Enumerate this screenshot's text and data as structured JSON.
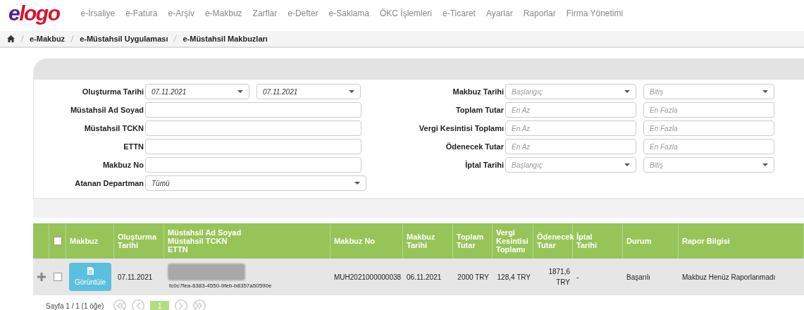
{
  "header": {
    "logo": {
      "prefix": "e",
      "name": "logo"
    },
    "menu": [
      "e-İrsaliye",
      "e-Fatura",
      "e-Arşiv",
      "e-Makbuz",
      "Zarflar",
      "e-Defter",
      "e-Saklama",
      "ÖKC İşlemleri",
      "e-Ticaret",
      "Ayarlar",
      "Raporlar",
      "Firma Yönetimi"
    ]
  },
  "breadcrumb": [
    "e-Makbuz",
    "e-Müstahsil Uygulaması",
    "e-Müstahsil Makbuzları"
  ],
  "filters": {
    "left": [
      {
        "label": "Oluşturma Tarihi",
        "kind": "date_range",
        "fields": [
          {
            "value": "07.11.2021"
          },
          {
            "value": "07.11.2021"
          }
        ]
      },
      {
        "label": "Müstahsil Ad Soyad",
        "kind": "text"
      },
      {
        "label": "Müstahsil TCKN",
        "kind": "text"
      },
      {
        "label": "ETTN",
        "kind": "text"
      },
      {
        "label": "Makbuz No",
        "kind": "text"
      },
      {
        "label": "Atanan Departman",
        "kind": "select",
        "fields": [
          {
            "value": "Tümü"
          }
        ]
      }
    ],
    "right": [
      {
        "label": "Makbuz Tarihi",
        "kind": "date_range",
        "fields": [
          {
            "placeholder": "Başlangıç"
          },
          {
            "placeholder": "Bitiş"
          }
        ]
      },
      {
        "label": "Toplam Tutar",
        "kind": "range",
        "fields": [
          {
            "placeholder": "En Az"
          },
          {
            "placeholder": "En Fazla"
          }
        ]
      },
      {
        "label": "Vergi Kesintisi Toplamı",
        "kind": "range",
        "fields": [
          {
            "placeholder": "En Az"
          },
          {
            "placeholder": "En Fazla"
          }
        ]
      },
      {
        "label": "Ödenecek Tutar",
        "kind": "range",
        "fields": [
          {
            "placeholder": "En Az"
          },
          {
            "placeholder": "En Fazla"
          }
        ]
      },
      {
        "label": "İptal Tarihi",
        "kind": "date_range",
        "fields": [
          {
            "placeholder": "Başlangıç"
          },
          {
            "placeholder": "Bitiş"
          }
        ]
      }
    ]
  },
  "table": {
    "select_all": {
      "checked": false
    },
    "columns": [
      [
        "Makbuz"
      ],
      [
        "Oluşturma",
        "Tarihi"
      ],
      [
        "Müstahsil Ad Soyad",
        "Müstahsil TCKN",
        "ETTN"
      ],
      [
        "Makbuz No"
      ],
      [
        "Makbuz",
        "Tarihi"
      ],
      [
        "Toplam",
        "Tutar"
      ],
      [
        "Vergi",
        "Kesintisi",
        "Toplamı"
      ],
      [
        "Ödenecek",
        "Tutar"
      ],
      [
        "İptal",
        "Tarihi"
      ],
      [
        "Durum"
      ],
      [
        "Rapor Bilgisi"
      ]
    ],
    "rows": [
      {
        "checked": false,
        "view_button": "Görüntüle",
        "created": "07.11.2021",
        "redacted": true,
        "ettn": "fc0c7fea-6383-4550-9feb-b8357a50590e",
        "receipt_no": "MUH2021000000038",
        "receipt_date": "06.11.2021",
        "total": "2000 TRY",
        "tax": "128,4 TRY",
        "payable": [
          "1871,6",
          "TRY"
        ],
        "cancel_date": "-",
        "status": "Başarılı",
        "report": "Makbuz Henüz Raporlanmadı"
      }
    ]
  },
  "pager": {
    "summary": "Sayfa 1 / 1 (1 öğe)",
    "pages": [
      {
        "label": "1",
        "selected": true
      }
    ]
  }
}
